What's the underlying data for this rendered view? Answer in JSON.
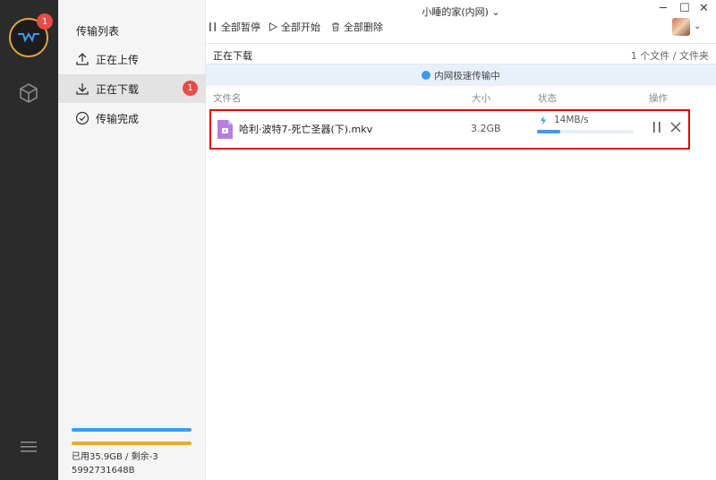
{
  "window": {
    "title": "小睡的家(内网) ⌄"
  },
  "rail": {
    "badge": "1"
  },
  "sidebar": {
    "title": "传输列表",
    "items": [
      {
        "label": "正在上传"
      },
      {
        "label": "正在下载",
        "badge": "1"
      },
      {
        "label": "传输完成"
      }
    ],
    "storage": {
      "text": "已用35.9GB / 剩余-35992731648B"
    }
  },
  "toolbar": {
    "pause_all": "全部暂停",
    "start_all": "全部开始",
    "delete_all": "全部删除"
  },
  "main": {
    "section_label": "正在下载",
    "count_label": "1 个文件 / 文件夹",
    "banner": "内网极速传输中",
    "columns": {
      "name": "文件名",
      "size": "大小",
      "status": "状态",
      "action": "操作"
    },
    "file": {
      "name": "哈利·波特7-死亡圣器(下).mkv",
      "size": "3.2GB",
      "speed": "14MB/s",
      "progress": 0.24
    }
  },
  "colors": {
    "accent": "#3d9be9",
    "badge": "#e94a4a",
    "highlight": "#e10000",
    "storage_orange": "#f0a73a"
  }
}
